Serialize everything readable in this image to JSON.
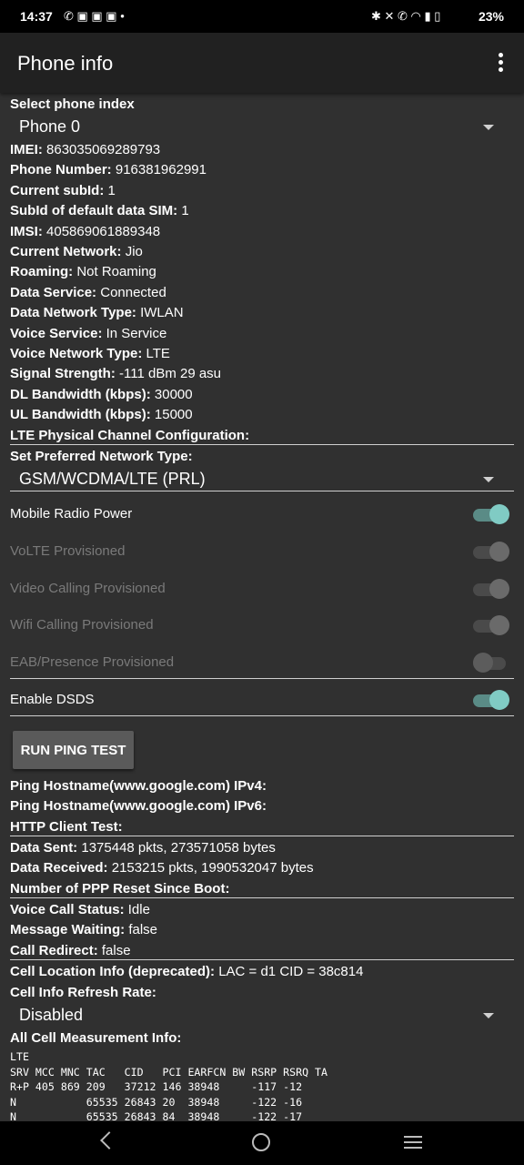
{
  "status_bar": {
    "time": "14:37",
    "battery": "23%",
    "left_icons": "✆ ▣ ▣ ▣ •",
    "right_icons": "✱ ✕ ✆ ◠ ▮ ▯"
  },
  "app_bar": {
    "title": "Phone info"
  },
  "phone_index": {
    "label": "Select phone index",
    "value": "Phone 0"
  },
  "info": [
    {
      "label": "IMEI:",
      "value": "863035069289793"
    },
    {
      "label": "Phone Number:",
      "value": "916381962991"
    },
    {
      "label": "Current subId:",
      "value": "1"
    },
    {
      "label": "SubId of default data SIM:",
      "value": "1"
    },
    {
      "label": "IMSI:",
      "value": "405869061889348"
    },
    {
      "label": "Current Network:",
      "value": "Jio"
    },
    {
      "label": "Roaming:",
      "value": "Not Roaming"
    },
    {
      "label": "Data Service:",
      "value": "Connected"
    },
    {
      "label": "Data Network Type:",
      "value": "IWLAN"
    },
    {
      "label": "Voice Service:",
      "value": "In Service"
    },
    {
      "label": "Voice Network Type:",
      "value": "LTE"
    },
    {
      "label": "Signal Strength:",
      "value": "-111 dBm   29 asu"
    },
    {
      "label": "DL Bandwidth (kbps):",
      "value": "30000"
    },
    {
      "label": "UL Bandwidth (kbps):",
      "value": "15000"
    },
    {
      "label": "LTE Physical Channel Configuration:",
      "value": ""
    }
  ],
  "preferred_network": {
    "label": "Set Preferred Network Type:",
    "value": "GSM/WCDMA/LTE (PRL)"
  },
  "toggles": [
    {
      "label": "Mobile Radio Power",
      "state": "on"
    },
    {
      "label": "VoLTE Provisioned",
      "state": "on-disabled"
    },
    {
      "label": "Video Calling Provisioned",
      "state": "on-disabled"
    },
    {
      "label": "Wifi Calling Provisioned",
      "state": "on-disabled"
    },
    {
      "label": "EAB/Presence Provisioned",
      "state": "off-disabled"
    },
    {
      "label": "Enable DSDS",
      "state": "on"
    }
  ],
  "ping_button": {
    "label": "RUN PING TEST"
  },
  "ping": [
    {
      "label": "Ping Hostname(www.google.com) IPv4:",
      "value": ""
    },
    {
      "label": "Ping Hostname(www.google.com) IPv6:",
      "value": ""
    },
    {
      "label": "HTTP Client Test:",
      "value": ""
    }
  ],
  "stats": [
    {
      "label": "Data Sent:",
      "value": "1375448 pkts, 273571058 bytes"
    },
    {
      "label": "Data Received:",
      "value": "2153215 pkts, 1990532047 bytes"
    },
    {
      "label": "Number of PPP Reset Since Boot:",
      "value": ""
    }
  ],
  "call": [
    {
      "label": "Voice Call Status:",
      "value": "Idle"
    },
    {
      "label": "Message Waiting:",
      "value": "false"
    },
    {
      "label": "Call Redirect:",
      "value": "false"
    }
  ],
  "cell_location": {
    "label": "Cell Location Info (deprecated):",
    "value": "LAC = d1   CID = 38c814"
  },
  "refresh_rate": {
    "label": "Cell Info Refresh Rate:",
    "value": "Disabled"
  },
  "cell_measure": {
    "label": "All Cell Measurement Info:",
    "lines": [
      "LTE",
      "SRV MCC MNC TAC   CID   PCI EARFCN BW RSRP RSRQ TA",
      "R+P 405 869 209   37212 146 38948     -117 -12",
      "N           65535 26843 20  38948     -122 -16",
      "N           65535 26843 84  38948     -122 -17"
    ]
  },
  "nav": {
    "back": "back-icon",
    "home": "home-icon",
    "recents": "recents-icon"
  }
}
